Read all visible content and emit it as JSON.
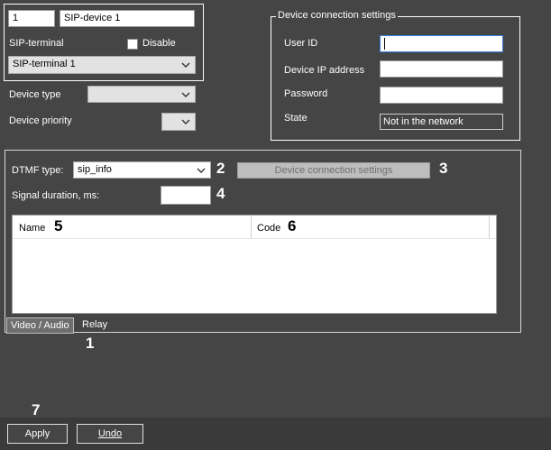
{
  "device": {
    "id": "1",
    "name": "SIP-device 1",
    "terminal_label": "SIP-terminal",
    "disable_label": "Disable",
    "terminal_selected": "SIP-terminal 1",
    "device_type_label": "Device type",
    "device_type_value": "",
    "device_priority_label": "Device priority",
    "device_priority_value": ""
  },
  "connection": {
    "group_title": "Device connection settings",
    "user_id_label": "User ID",
    "user_id_value": "",
    "ip_label": "Device IP address",
    "ip_value": "",
    "password_label": "Password",
    "password_value": "",
    "state_label": "State",
    "state_value": "Not in the network"
  },
  "dtmf": {
    "type_label": "DTMF type:",
    "type_value": "sip_info",
    "connection_button": "Device connection settings",
    "signal_label": "Signal duration, ms:",
    "signal_value": "",
    "columns": [
      "Name",
      "Code"
    ]
  },
  "tabs": [
    "Video / Audio",
    "Relay"
  ],
  "buttons": {
    "apply": "Apply",
    "undo": "Undo"
  },
  "callouts": [
    "1",
    "2",
    "3",
    "4",
    "5",
    "6",
    "7"
  ]
}
